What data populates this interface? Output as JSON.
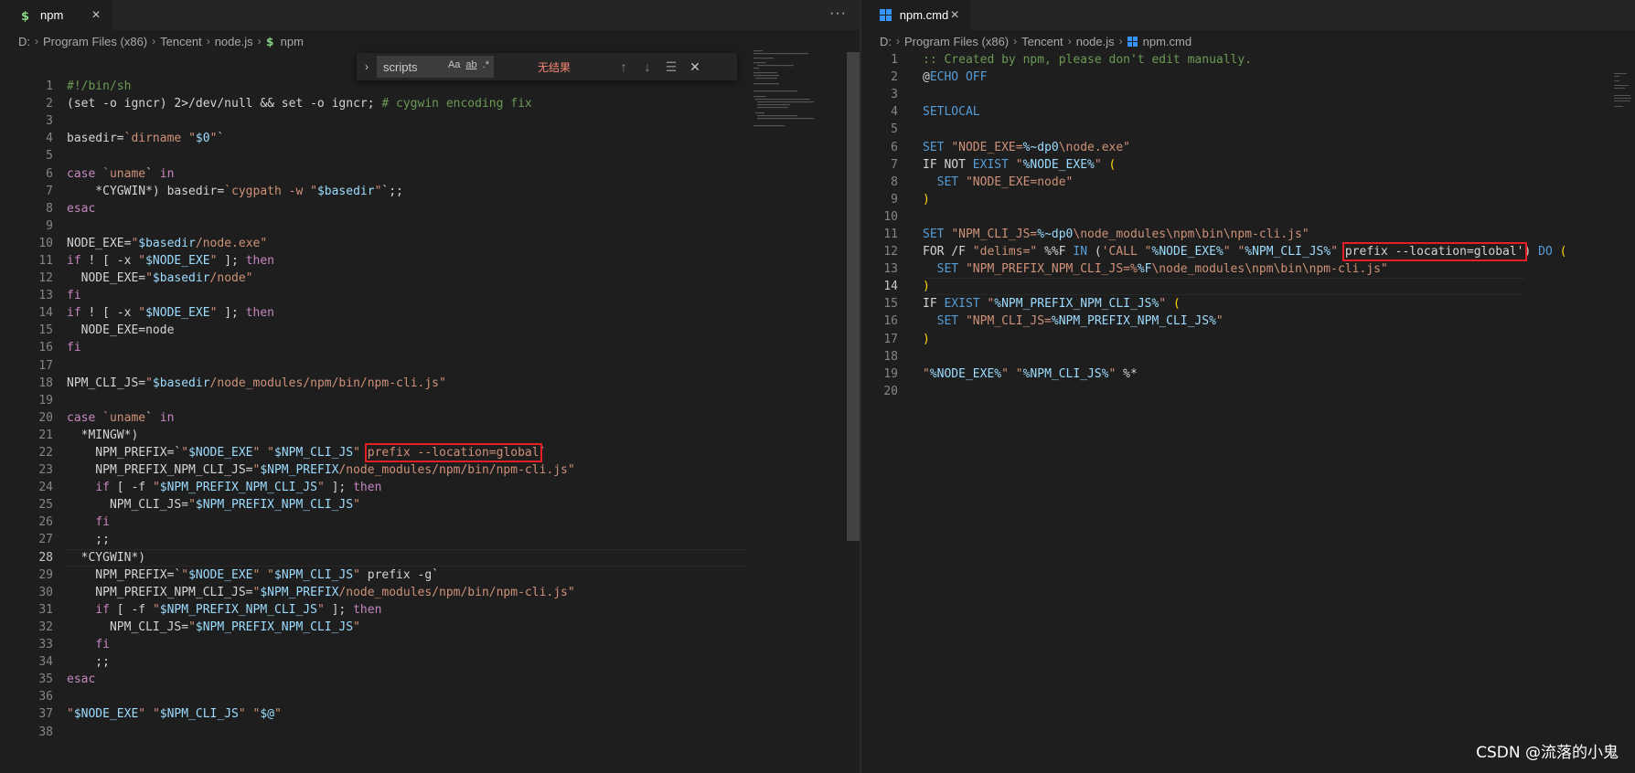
{
  "left": {
    "tab": {
      "label": "npm",
      "icon": "dollar-icon"
    },
    "more_label": "···",
    "breadcrumb": [
      "D:",
      "Program Files (x86)",
      "Tencent",
      "node.js",
      "npm"
    ],
    "find": {
      "query": "scripts",
      "match_case": "Aa",
      "whole_word": "ab",
      "regex": ".*",
      "result": "无结果"
    },
    "lines": [
      {
        "n": "1",
        "code": "#!/bin/sh"
      },
      {
        "n": "2",
        "code": "(set -o igncr) 2>/dev/null && set -o igncr; # cygwin encoding fix"
      },
      {
        "n": "3",
        "code": ""
      },
      {
        "n": "4",
        "code": "basedir=`dirname \"$0\"`"
      },
      {
        "n": "5",
        "code": ""
      },
      {
        "n": "6",
        "code": "case `uname` in"
      },
      {
        "n": "7",
        "code": "    *CYGWIN*) basedir=`cygpath -w \"$basedir\"`;;"
      },
      {
        "n": "8",
        "code": "esac"
      },
      {
        "n": "9",
        "code": ""
      },
      {
        "n": "10",
        "code": "NODE_EXE=\"$basedir/node.exe\""
      },
      {
        "n": "11",
        "code": "if ! [ -x \"$NODE_EXE\" ]; then"
      },
      {
        "n": "12",
        "code": "  NODE_EXE=\"$basedir/node\""
      },
      {
        "n": "13",
        "code": "fi"
      },
      {
        "n": "14",
        "code": "if ! [ -x \"$NODE_EXE\" ]; then"
      },
      {
        "n": "15",
        "code": "  NODE_EXE=node"
      },
      {
        "n": "16",
        "code": "fi"
      },
      {
        "n": "17",
        "code": ""
      },
      {
        "n": "18",
        "code": "NPM_CLI_JS=\"$basedir/node_modules/npm/bin/npm-cli.js\""
      },
      {
        "n": "19",
        "code": ""
      },
      {
        "n": "20",
        "code": "case `uname` in"
      },
      {
        "n": "21",
        "code": "  *MINGW*)"
      },
      {
        "n": "22",
        "code": "    NPM_PREFIX=`\"$NODE_EXE\" \"$NPM_CLI_JS\" prefix --location=global`"
      },
      {
        "n": "23",
        "code": "    NPM_PREFIX_NPM_CLI_JS=\"$NPM_PREFIX/node_modules/npm/bin/npm-cli.js\""
      },
      {
        "n": "24",
        "code": "    if [ -f \"$NPM_PREFIX_NPM_CLI_JS\" ]; then"
      },
      {
        "n": "25",
        "code": "      NPM_CLI_JS=\"$NPM_PREFIX_NPM_CLI_JS\""
      },
      {
        "n": "26",
        "code": "    fi"
      },
      {
        "n": "27",
        "code": "    ;;"
      },
      {
        "n": "28",
        "code": "  *CYGWIN*)"
      },
      {
        "n": "29",
        "code": "    NPM_PREFIX=`\"$NODE_EXE\" \"$NPM_CLI_JS\" prefix -g`"
      },
      {
        "n": "30",
        "code": "    NPM_PREFIX_NPM_CLI_JS=\"$NPM_PREFIX/node_modules/npm/bin/npm-cli.js\""
      },
      {
        "n": "31",
        "code": "    if [ -f \"$NPM_PREFIX_NPM_CLI_JS\" ]; then"
      },
      {
        "n": "32",
        "code": "      NPM_CLI_JS=\"$NPM_PREFIX_NPM_CLI_JS\""
      },
      {
        "n": "33",
        "code": "    fi"
      },
      {
        "n": "34",
        "code": "    ;;"
      },
      {
        "n": "35",
        "code": "esac"
      },
      {
        "n": "36",
        "code": ""
      },
      {
        "n": "37",
        "code": "\"$NODE_EXE\" \"$NPM_CLI_JS\" \"$@\""
      },
      {
        "n": "38",
        "code": ""
      }
    ],
    "active_line": "28"
  },
  "right": {
    "tab": {
      "label": "npm.cmd",
      "icon": "windows-icon"
    },
    "breadcrumb": [
      "D:",
      "Program Files (x86)",
      "Tencent",
      "node.js",
      "npm.cmd"
    ],
    "lines": [
      {
        "n": "1",
        "code": ":: Created by npm, please don't edit manually."
      },
      {
        "n": "2",
        "code": "@ECHO OFF"
      },
      {
        "n": "3",
        "code": ""
      },
      {
        "n": "4",
        "code": "SETLOCAL"
      },
      {
        "n": "5",
        "code": ""
      },
      {
        "n": "6",
        "code": "SET \"NODE_EXE=%~dp0\\node.exe\""
      },
      {
        "n": "7",
        "code": "IF NOT EXIST \"%NODE_EXE%\" ("
      },
      {
        "n": "8",
        "code": "  SET \"NODE_EXE=node\""
      },
      {
        "n": "9",
        "code": ")"
      },
      {
        "n": "10",
        "code": ""
      },
      {
        "n": "11",
        "code": "SET \"NPM_CLI_JS=%~dp0\\node_modules\\npm\\bin\\npm-cli.js\""
      },
      {
        "n": "12",
        "code": "FOR /F \"delims=\" %%F IN ('CALL \"%NODE_EXE%\" \"%NPM_CLI_JS%\" prefix --location=global') DO ("
      },
      {
        "n": "13",
        "code": "  SET \"NPM_PREFIX_NPM_CLI_JS=%%F\\node_modules\\npm\\bin\\npm-cli.js\""
      },
      {
        "n": "14",
        "code": ")"
      },
      {
        "n": "15",
        "code": "IF EXIST \"%NPM_PREFIX_NPM_CLI_JS%\" ("
      },
      {
        "n": "16",
        "code": "  SET \"NPM_CLI_JS=%NPM_PREFIX_NPM_CLI_JS%\""
      },
      {
        "n": "17",
        "code": ")"
      },
      {
        "n": "18",
        "code": ""
      },
      {
        "n": "19",
        "code": "\"%NODE_EXE%\" \"%NPM_CLI_JS%\" %*"
      },
      {
        "n": "20",
        "code": ""
      }
    ],
    "active_line": "14"
  },
  "watermark": "CSDN @流落的小鬼",
  "colors": {
    "background": "#1e1e1e",
    "highlight_box": "#e51f26",
    "comment": "#6a9955",
    "keyword": "#c586c0",
    "string": "#ce9178",
    "variable": "#9cdcfe"
  }
}
